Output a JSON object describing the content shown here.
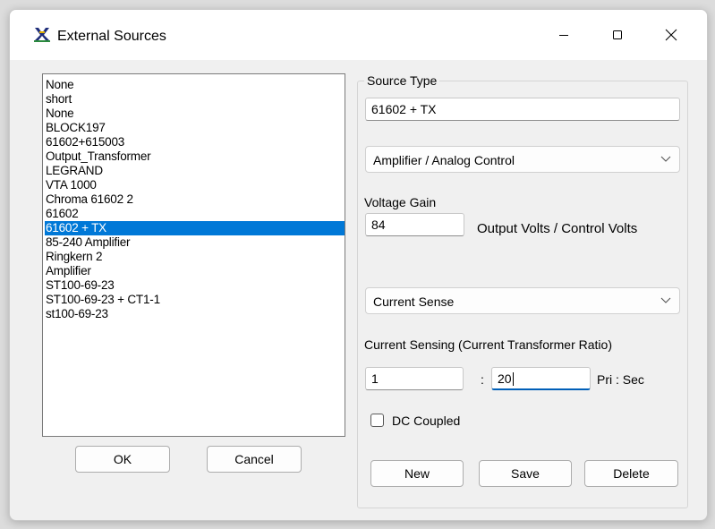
{
  "window": {
    "title": "External Sources",
    "icon": "app-logo-icon"
  },
  "title_controls": {
    "minimize": "minimize-icon",
    "maximize": "maximize-icon",
    "close": "close-icon"
  },
  "source_list": {
    "items": [
      "None",
      "short",
      "None",
      "BLOCK197",
      "61602+615003",
      "Output_Transformer",
      "LEGRAND",
      "VTA 1000",
      "Chroma 61602 2",
      "61602",
      "61602 + TX",
      "85-240 Amplifier",
      "Ringkern 2",
      "Amplifier",
      "ST100-69-23",
      "ST100-69-23 + CT1-1",
      "st100-69-23"
    ],
    "selected_index": 10
  },
  "buttons": {
    "ok": "OK",
    "cancel": "Cancel",
    "new": "New",
    "save": "Save",
    "delete": "Delete"
  },
  "source_type": {
    "group_label": "Source Type",
    "name_value": "61602 + TX",
    "type_dropdown": "Amplifier / Analog Control",
    "voltage_gain_label": "Voltage Gain",
    "voltage_gain_value": "84",
    "voltage_gain_units": "Output Volts / Control Volts",
    "current_sense_dropdown": "Current Sense",
    "ct_ratio_label": "Current Sensing (Current Transformer Ratio)",
    "ct_primary": "1",
    "ct_separator": ":",
    "ct_secondary": "20",
    "ct_units": "Pri : Sec",
    "dc_coupled_label": "DC Coupled",
    "dc_coupled_checked": false
  },
  "colors": {
    "selection": "#0078d7",
    "focus_underline": "#005fb8"
  }
}
